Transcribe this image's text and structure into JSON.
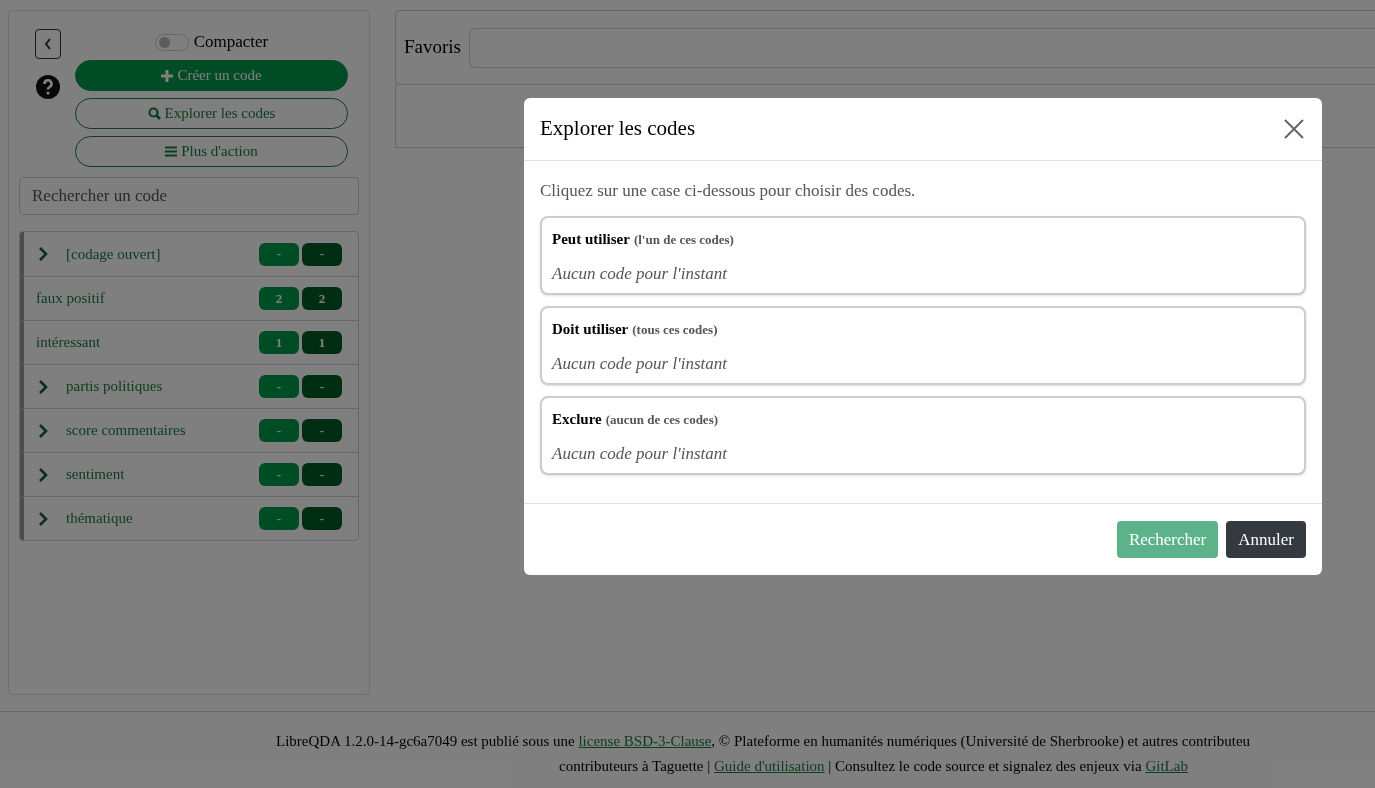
{
  "sidebar": {
    "compact_toggle": {
      "label": "Compacter",
      "on": false
    },
    "buttons": [
      {
        "label": "Créer un code",
        "kind": "filled"
      },
      {
        "label": "Explorer les codes",
        "kind": "outline"
      },
      {
        "label": "Plus d'action",
        "kind": "outline"
      }
    ],
    "search": {
      "placeholder": "Rechercher un code"
    },
    "codes": [
      {
        "name": "[codage ouvert]",
        "expandable": true,
        "count_1": "-",
        "count_2": "-"
      },
      {
        "name": "faux positif",
        "expandable": false,
        "count_1": "2",
        "count_2": "2"
      },
      {
        "name": "intéressant",
        "expandable": false,
        "count_1": "1",
        "count_2": "1"
      },
      {
        "name": "partis politiques",
        "expandable": true,
        "count_1": "-",
        "count_2": "-"
      },
      {
        "name": "score commentaires",
        "expandable": true,
        "count_1": "-",
        "count_2": "-"
      },
      {
        "name": "sentiment",
        "expandable": true,
        "count_1": "-",
        "count_2": "-"
      },
      {
        "name": "thématique",
        "expandable": true,
        "count_1": "-",
        "count_2": "-"
      }
    ]
  },
  "favorites": {
    "label": "Favoris"
  },
  "modal": {
    "title": "Explorer les codes",
    "instruction": "Cliquez sur une case ci-dessous pour choisir des codes.",
    "boxes": [
      {
        "title": "Peut utiliser",
        "hint": "(l'un de ces codes)",
        "empty": "Aucun code pour l'instant"
      },
      {
        "title": "Doit utiliser",
        "hint": "(tous ces codes)",
        "empty": "Aucun code pour l'instant"
      },
      {
        "title": "Exclure",
        "hint": "(aucun de ces codes)",
        "empty": "Aucun code pour l'instant"
      }
    ],
    "buttons": [
      {
        "label": "Rechercher",
        "kind": "primary"
      },
      {
        "label": "Annuler",
        "kind": "secondary"
      }
    ]
  },
  "footer": {
    "line_1": [
      {
        "text": "LibreQDA 1.2.0-14-gc6a7049 est publié sous une ",
        "link": false
      },
      {
        "text": "license BSD-3-Clause",
        "link": true
      },
      {
        "text": ", © Plateforme en humanités numériques (Université de Sherbrooke) et autres contributeu",
        "link": false
      }
    ],
    "line_2": [
      {
        "text": "contributeurs à Taguette | ",
        "link": false
      },
      {
        "text": "Guide d'utilisation",
        "link": true
      },
      {
        "text": " | Consultez le code source et signalez des enjeux via ",
        "link": false
      },
      {
        "text": "GitLab",
        "link": true
      }
    ]
  }
}
